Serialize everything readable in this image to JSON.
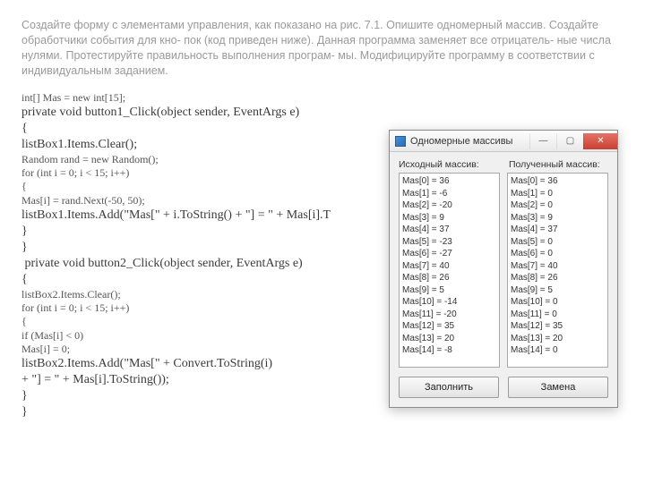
{
  "instruction": "Создайте форму с элементами управления, как показано на рис. 7.1. Опишите одномерный массив. Создайте обработчики события для кно- пок (код приведен ниже). Данная программа заменяет все отрицатель- ные числа нулями. Протестируйте правильность выполнения програм- мы. Модифицируйте программу в соответствии с индивидуальным заданием.",
  "code": {
    "l01": "int[] Mas = new int[15];",
    "l02": "private void button1_Click(object sender, EventArgs e)",
    "l03": "{",
    "l04": "listBox1.Items.Clear();",
    "l05": "Random rand = new Random();",
    "l06": "for (int i = 0; i < 15; i++)",
    "l07": "{",
    "l08": "Mas[i] = rand.Next(-50, 50);",
    "l09": "",
    "l10": "listBox1.Items.Add(\"Mas[\" + i.ToString() + \"] = \" + Mas[i].T",
    "l11": "}",
    "l12": "}",
    "l13": " private void button2_Click(object sender, EventArgs e)",
    "l14": "{",
    "l15": "listBox2.Items.Clear();",
    "l16": "for (int i = 0; i < 15; i++)",
    "l17": "{",
    "l18": "if (Mas[i] < 0)",
    "l19": "Mas[i] = 0;",
    "l20": "listBox2.Items.Add(\"Mas[\" + Convert.ToString(i)",
    "l21": "+ \"] = \" + Mas[i].ToString());",
    "l22": "}",
    "l23": "}"
  },
  "window": {
    "title": "Одномерные массивы",
    "label_src": "Исходный массив:",
    "label_res": "Полученный массив:",
    "btn_fill": "Заполнить",
    "btn_replace": "Замена",
    "list_src": [
      "Mas[0] = 36",
      "Mas[1] = -6",
      "Mas[2] = -20",
      "Mas[3] = 9",
      "Mas[4] = 37",
      "Mas[5] = -23",
      "Mas[6] = -27",
      "Mas[7] = 40",
      "Mas[8] = 26",
      "Mas[9] = 5",
      "Mas[10] = -14",
      "Mas[11] = -20",
      "Mas[12] = 35",
      "Mas[13] = 20",
      "Mas[14] = -8"
    ],
    "list_res": [
      "Mas[0] = 36",
      "Mas[1] = 0",
      "Mas[2] = 0",
      "Mas[3] = 9",
      "Mas[4] = 37",
      "Mas[5] = 0",
      "Mas[6] = 0",
      "Mas[7] = 40",
      "Mas[8] = 26",
      "Mas[9] = 5",
      "Mas[10] = 0",
      "Mas[11] = 0",
      "Mas[12] = 35",
      "Mas[13] = 20",
      "Mas[14] = 0"
    ]
  }
}
